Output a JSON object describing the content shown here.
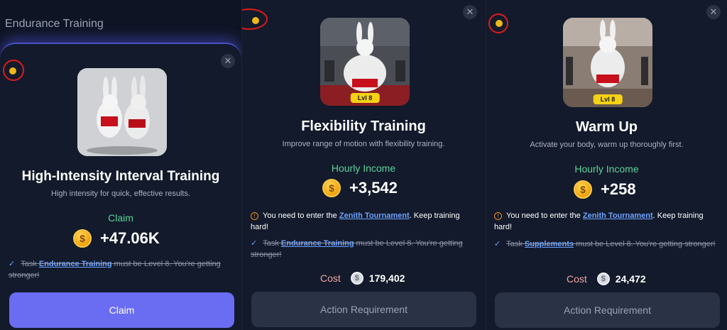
{
  "header": {
    "title": "Endurance Training"
  },
  "cards": [
    {
      "heading": "High-Intensity Interval Training",
      "description": "High intensity for quick, effective results.",
      "income_label": "Claim",
      "amount": "+47.06K",
      "task_prefix": "Task",
      "task_link": "Endurance Training",
      "task_suffix": "must be Level 8. You're getting stronger!",
      "button": "Claim"
    },
    {
      "heading": "Flexibility Training",
      "description": "Improve range of motion with flexibility training.",
      "income_label": "Hourly Income",
      "amount": "+3,542",
      "level_badge": "Lvl 8",
      "notice_prefix": "You need to enter the",
      "notice_link": "Zenith Tournament",
      "notice_suffix": ". Keep training hard!",
      "task_prefix": "Task",
      "task_link": "Endurance Training",
      "task_suffix": "must be Level 8. You're getting stronger!",
      "cost_label": "Cost",
      "cost_value": "179,402",
      "button": "Action Requirement"
    },
    {
      "heading": "Warm Up",
      "description": "Activate your body, warm up thoroughly first.",
      "income_label": "Hourly Income",
      "amount": "+258",
      "level_badge": "Lvl 8",
      "notice_prefix": "You need to enter the",
      "notice_link": "Zenith Tournament",
      "notice_suffix": ". Keep training hard!",
      "task_prefix": "Task",
      "task_link": "Supplements",
      "task_suffix": "must be Level 8. You're getting stronger!",
      "cost_label": "Cost",
      "cost_value": "24,472",
      "button": "Action Requirement"
    }
  ],
  "icons": {
    "close": "✕",
    "coin": "$",
    "warning": "!",
    "check": "✓"
  },
  "colors": {
    "accent": "#6a6cf2",
    "income_green": "#5fd39a",
    "link_blue": "#6ea3ff",
    "coin_gold": "#f3b71a",
    "level_badge": "#f5d215",
    "highlight_ring": "#e01b1b"
  }
}
